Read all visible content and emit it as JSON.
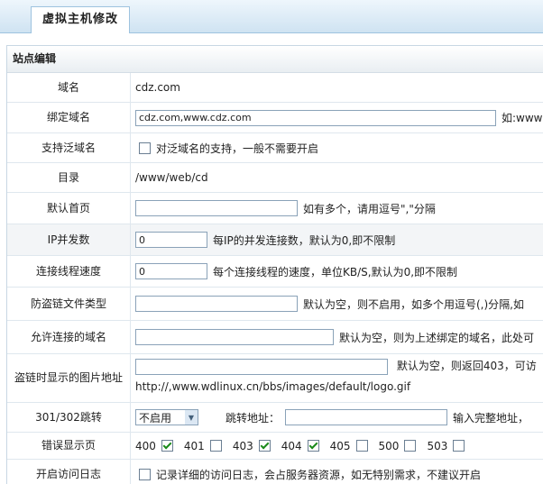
{
  "tab": {
    "title": "虚拟主机修改"
  },
  "panel": {
    "title": "站点编辑"
  },
  "rows": {
    "domain": {
      "label": "域名",
      "value": "cdz.com"
    },
    "bind_domain": {
      "label": "绑定域名",
      "value": "cdz.com,www.cdz.com",
      "hint": "如:www"
    },
    "wildcard": {
      "label": "支持泛域名",
      "hint": "对泛域名的支持，一般不需要开启"
    },
    "directory": {
      "label": "目录",
      "value": "/www/web/cd"
    },
    "default_page": {
      "label": "默认首页",
      "value": "",
      "hint": "如有多个，请用逗号\",\"分隔"
    },
    "ip_concurrency": {
      "label": "IP并发数",
      "value": "0",
      "hint": "每IP的并发连接数，默认为0,即不限制"
    },
    "thread_speed": {
      "label": "连接线程速度",
      "value": "0",
      "hint": "每个连接线程的速度，单位KB/S,默认为0,即不限制"
    },
    "hotlink_types": {
      "label": "防盗链文件类型",
      "value": "",
      "hint": "默认为空，则不启用，如多个用逗号(,)分隔,如"
    },
    "allowed_domains": {
      "label": "允许连接的域名",
      "value": "",
      "hint": "默认为空，则为上述绑定的域名，此处可"
    },
    "hotlink_image": {
      "label": "盗链时显示的图片地址",
      "value": "",
      "hint": "默认为空，则返回403，可访",
      "example": "http://,www.wdlinux.cn/bbs/images/default/logo.gif"
    },
    "redirect": {
      "label": "301/302跳转",
      "select": "不启用",
      "target_label": "跳转地址：",
      "value": "",
      "hint": "输入完整地址，"
    },
    "error_pages": {
      "label": "错误显示页",
      "codes": [
        {
          "code": "400",
          "checked": true
        },
        {
          "code": "401",
          "checked": false
        },
        {
          "code": "403",
          "checked": true
        },
        {
          "code": "404",
          "checked": true
        },
        {
          "code": "405",
          "checked": false
        },
        {
          "code": "500",
          "checked": false
        },
        {
          "code": "503",
          "checked": false
        }
      ]
    },
    "access_log": {
      "label": "开启访问日志",
      "hint": "记录详细的访问日志，会占服务器资源，如无特别需求，不建议开启"
    }
  }
}
